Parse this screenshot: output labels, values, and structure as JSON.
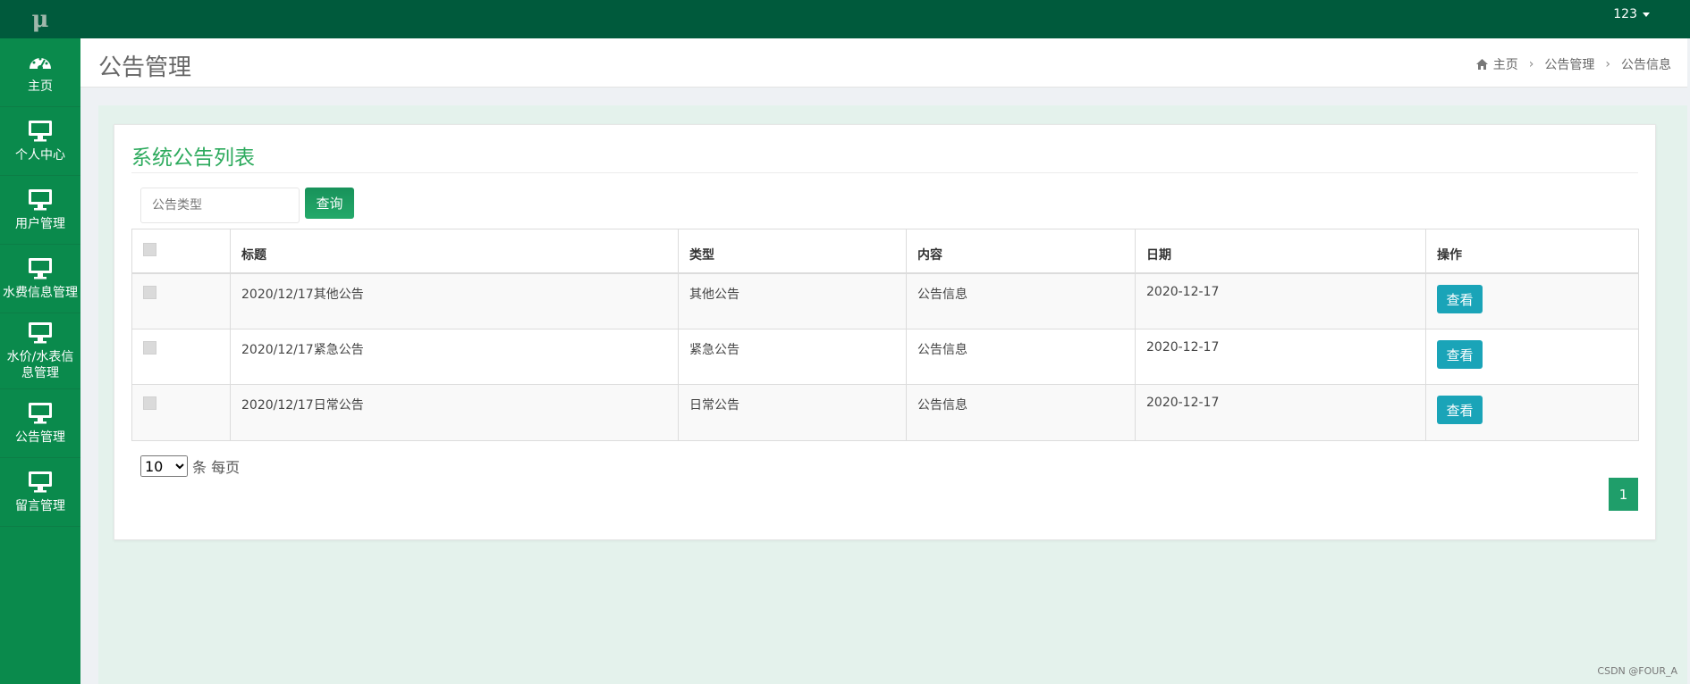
{
  "app": {
    "logo": "μ"
  },
  "user": {
    "name": "123"
  },
  "sidebar": {
    "items": [
      {
        "label": "主页",
        "icon": "dashboard-icon"
      },
      {
        "label": "个人中心",
        "icon": "monitor-icon"
      },
      {
        "label": "用户管理",
        "icon": "monitor-icon"
      },
      {
        "label": "水费信息管理",
        "icon": "monitor-icon"
      },
      {
        "label": "水价/水表信息管理",
        "icon": "monitor-icon"
      },
      {
        "label": "公告管理",
        "icon": "monitor-icon"
      },
      {
        "label": "留言管理",
        "icon": "monitor-icon"
      }
    ]
  },
  "header": {
    "title": "公告管理",
    "breadcrumb": [
      "主页",
      "公告管理",
      "公告信息"
    ]
  },
  "panel": {
    "title": "系统公告列表",
    "search_placeholder": "公告类型",
    "search_button": "查询"
  },
  "table": {
    "columns": [
      "标题",
      "类型",
      "内容",
      "日期",
      "操作"
    ],
    "rows": [
      {
        "title": "2020/12/17其他公告",
        "type": "其他公告",
        "content": "公告信息",
        "date": "2020-12-17",
        "action": "查看"
      },
      {
        "title": "2020/12/17紧急公告",
        "type": "紧急公告",
        "content": "公告信息",
        "date": "2020-12-17",
        "action": "查看"
      },
      {
        "title": "2020/12/17日常公告",
        "type": "日常公告",
        "content": "公告信息",
        "date": "2020-12-17",
        "action": "查看"
      }
    ]
  },
  "pagination": {
    "page_size": "10",
    "page_size_suffix": "条 每页",
    "current_page": "1"
  },
  "colors": {
    "sidebar": "#0a8a4c",
    "topbar": "#005a3c",
    "accent_green": "#2daa5d",
    "view_button": "#1aa4b8"
  },
  "watermark": "CSDN @FOUR_A"
}
